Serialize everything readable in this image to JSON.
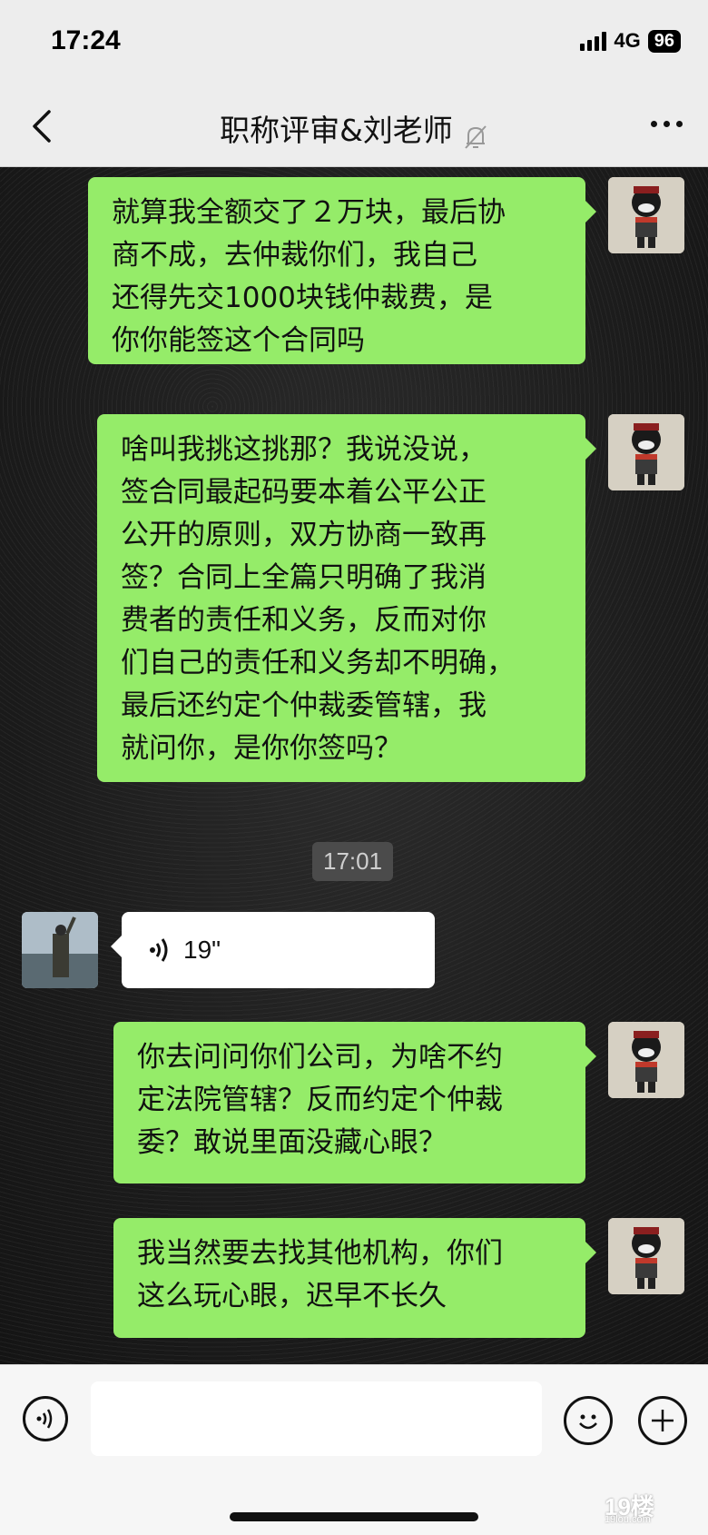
{
  "status": {
    "time": "17:24",
    "network": "4G",
    "battery": "96"
  },
  "header": {
    "title": "职称评审&刘老师"
  },
  "messages": [
    {
      "text_lines": [
        "就算我全额交了２万块，最后协",
        "商不成，去仲裁你们，我自己",
        "还得先交1000块钱仲裁费，是",
        "你你能签这个合同吗"
      ]
    },
    {
      "text_lines": [
        "啥叫我挑这挑那？我说没说，",
        "签合同最起码要本着公平公正",
        "公开的原则，双方协商一致再",
        "签？合同上全篇只明确了我消",
        "费者的责任和义务，反而对你",
        "们自己的责任和义务却不明确，",
        "最后还约定个仲裁委管辖，我",
        "就问你，是你你签吗？"
      ]
    },
    {
      "timestamp": "17:01"
    },
    {
      "voice_duration": "19\""
    },
    {
      "text_lines": [
        "你去问问你们公司，为啥不约",
        "定法院管辖？反而约定个仲裁",
        "委？敢说里面没藏心眼？"
      ]
    },
    {
      "text_lines": [
        "我当然要去找其他机构，你们",
        "这么玩心眼，迟早不长久"
      ]
    }
  ],
  "input": {
    "value": ""
  },
  "watermark": {
    "text": "19楼",
    "sub": "19lou.com"
  },
  "icons": [
    "back-chevron-icon",
    "mute-bell-icon",
    "more-dots-icon",
    "voice-toggle-icon",
    "emoji-icon",
    "plus-icon",
    "voice-wave-icon"
  ],
  "colors": {
    "bubble_self": "#95ec69",
    "bubble_other": "#ffffff",
    "header_bg": "#ededed"
  }
}
